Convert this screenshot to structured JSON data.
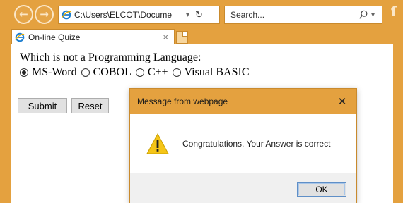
{
  "browser": {
    "address": "C:\\Users\\ELCOT\\Docume",
    "address_dropdown": "▾",
    "refresh_glyph": "↻",
    "search_placeholder": "Search...",
    "search_dropdown": "▾",
    "tab_title": "On-line Quize",
    "tab_close": "×",
    "accent_color": "#e4a13f"
  },
  "page": {
    "question": "Which is not a Programming Language:",
    "options": [
      {
        "label": "MS-Word",
        "selected": true
      },
      {
        "label": "COBOL",
        "selected": false
      },
      {
        "label": "C++",
        "selected": false
      },
      {
        "label": "Visual BASIC",
        "selected": false
      }
    ],
    "submit_label": "Submit",
    "reset_label": "Reset"
  },
  "dialog": {
    "title": "Message from webpage",
    "close_glyph": "✕",
    "message": "Congratulations, Your Answer is correct",
    "ok_label": "OK",
    "icon": "warning-icon"
  }
}
